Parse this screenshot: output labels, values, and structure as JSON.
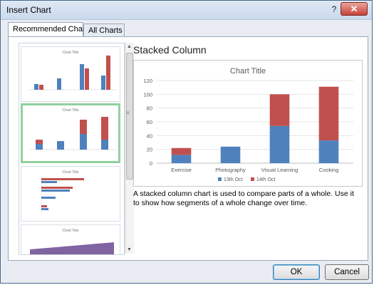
{
  "window": {
    "title": "Insert Chart",
    "help_glyph": "?",
    "close_glyph": "✕"
  },
  "tabs": [
    {
      "label": "Recommended Charts",
      "active": true
    },
    {
      "label": "All Charts",
      "active": false
    }
  ],
  "thumbnails": [
    {
      "title": "Chart Title",
      "kind": "clustered-column",
      "selected": false
    },
    {
      "title": "Chart Title",
      "kind": "stacked-column",
      "selected": true
    },
    {
      "title": "Chart Title",
      "kind": "clustered-bar",
      "selected": false
    },
    {
      "title": "Chart Title",
      "kind": "area",
      "selected": false
    }
  ],
  "preview": {
    "heading": "Stacked Column",
    "description": "A stacked column chart is used to compare parts of a whole. Use it to show how segments of a whole change over time."
  },
  "chart_data": {
    "type": "bar",
    "stacked": true,
    "title": "Chart Title",
    "categories": [
      "Exercise",
      "Photography",
      "Visual Learning",
      "Cooking"
    ],
    "series": [
      {
        "name": "13th Oct",
        "color": "#4f81bd",
        "values": [
          12,
          24,
          54,
          33
        ]
      },
      {
        "name": "14th Oct",
        "color": "#c0504d",
        "values": [
          10,
          0,
          46,
          78
        ]
      }
    ],
    "ylim": [
      0,
      120
    ],
    "yticks": [
      "0",
      "20",
      "40",
      "60",
      "80",
      "100",
      "120"
    ],
    "grid": true,
    "legend": "bottom"
  },
  "buttons": {
    "ok": "OK",
    "cancel": "Cancel"
  },
  "icons": {
    "help": "help-icon",
    "close": "close-icon"
  }
}
